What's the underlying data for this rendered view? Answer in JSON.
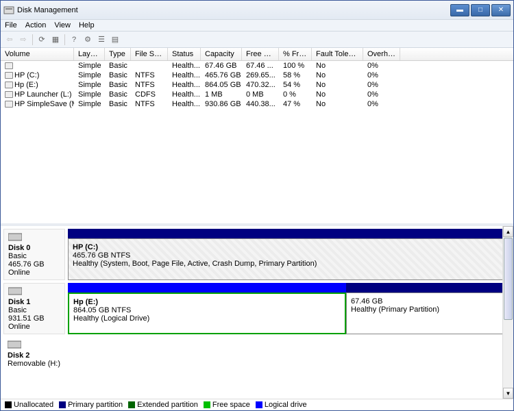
{
  "window": {
    "title": "Disk Management"
  },
  "menu": {
    "file": "File",
    "action": "Action",
    "view": "View",
    "help": "Help"
  },
  "columns": {
    "c0": "Volume",
    "c1": "Layout",
    "c2": "Type",
    "c3": "File Sys...",
    "c4": "Status",
    "c5": "Capacity",
    "c6": "Free S...",
    "c7": "% Free",
    "c8": "Fault Tolera...",
    "c9": "Overhe..."
  },
  "volumes": [
    {
      "name": "",
      "layout": "Simple",
      "type": "Basic",
      "fs": "",
      "status": "Health...",
      "capacity": "67.46 GB",
      "free": "67.46 ...",
      "pct": "100 %",
      "fault": "No",
      "overhead": "0%"
    },
    {
      "name": "HP (C:)",
      "layout": "Simple",
      "type": "Basic",
      "fs": "NTFS",
      "status": "Health...",
      "capacity": "465.76 GB",
      "free": "269.65...",
      "pct": "58 %",
      "fault": "No",
      "overhead": "0%"
    },
    {
      "name": "Hp (E:)",
      "layout": "Simple",
      "type": "Basic",
      "fs": "NTFS",
      "status": "Health...",
      "capacity": "864.05 GB",
      "free": "470.32...",
      "pct": "54 %",
      "fault": "No",
      "overhead": "0%"
    },
    {
      "name": "HP Launcher (L:)",
      "layout": "Simple",
      "type": "Basic",
      "fs": "CDFS",
      "status": "Health...",
      "capacity": "1 MB",
      "free": "0 MB",
      "pct": "0 %",
      "fault": "No",
      "overhead": "0%"
    },
    {
      "name": "HP SimpleSave (M:)",
      "layout": "Simple",
      "type": "Basic",
      "fs": "NTFS",
      "status": "Health...",
      "capacity": "930.86 GB",
      "free": "440.38...",
      "pct": "47 %",
      "fault": "No",
      "overhead": "0%"
    }
  ],
  "disks": {
    "d0": {
      "name": "Disk 0",
      "type": "Basic",
      "size": "465.76 GB",
      "status": "Online",
      "part": {
        "name": "HP  (C:)",
        "info": "465.76 GB NTFS",
        "status": "Healthy (System, Boot, Page File, Active, Crash Dump, Primary Partition)"
      }
    },
    "d1": {
      "name": "Disk 1",
      "type": "Basic",
      "size": "931.51 GB",
      "status": "Online",
      "p1": {
        "name": "Hp  (E:)",
        "info": "864.05 GB NTFS",
        "status": "Healthy (Logical Drive)"
      },
      "p2": {
        "name": "",
        "info": "67.46 GB",
        "status": "Healthy (Primary Partition)"
      }
    },
    "d2": {
      "name": "Disk 2",
      "type": "Removable (H:)"
    }
  },
  "legend": {
    "unalloc": "Unallocated",
    "primary": "Primary partition",
    "extended": "Extended partition",
    "free": "Free space",
    "logical": "Logical drive"
  }
}
